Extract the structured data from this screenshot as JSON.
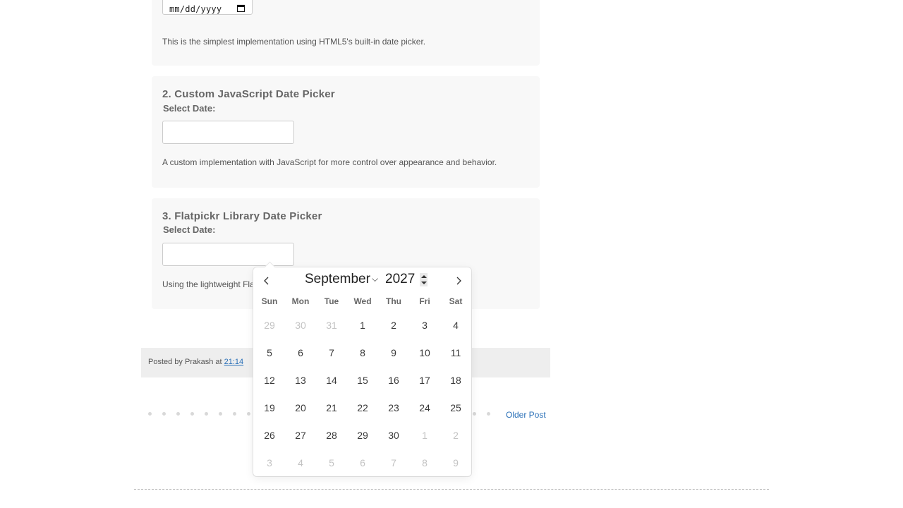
{
  "section1": {
    "date_placeholder": "mm/dd/yyyy",
    "description": "This is the simplest implementation using HTML5's built-in date picker."
  },
  "section2": {
    "title": "2. Custom JavaScript Date Picker",
    "label": "Select Date:",
    "description": "A custom implementation with JavaScript for more control over appearance and behavior."
  },
  "section3": {
    "title": "3. Flatpickr Library Date Picker",
    "label": "Select Date:",
    "description_visible": "Using the lightweight Fla"
  },
  "footer": {
    "posted_by_prefix": "Posted by Prakash at",
    "time": "21:14",
    "older_post": "Older Post"
  },
  "calendar": {
    "month": "September",
    "year": "2027",
    "weekdays": [
      "Sun",
      "Mon",
      "Tue",
      "Wed",
      "Thu",
      "Fri",
      "Sat"
    ],
    "weeks": [
      [
        {
          "d": "29",
          "m": true
        },
        {
          "d": "30",
          "m": true
        },
        {
          "d": "31",
          "m": true
        },
        {
          "d": "1"
        },
        {
          "d": "2"
        },
        {
          "d": "3"
        },
        {
          "d": "4"
        }
      ],
      [
        {
          "d": "5"
        },
        {
          "d": "6"
        },
        {
          "d": "7"
        },
        {
          "d": "8"
        },
        {
          "d": "9"
        },
        {
          "d": "10"
        },
        {
          "d": "11"
        }
      ],
      [
        {
          "d": "12"
        },
        {
          "d": "13"
        },
        {
          "d": "14"
        },
        {
          "d": "15"
        },
        {
          "d": "16"
        },
        {
          "d": "17"
        },
        {
          "d": "18"
        }
      ],
      [
        {
          "d": "19"
        },
        {
          "d": "20"
        },
        {
          "d": "21"
        },
        {
          "d": "22"
        },
        {
          "d": "23"
        },
        {
          "d": "24"
        },
        {
          "d": "25"
        }
      ],
      [
        {
          "d": "26"
        },
        {
          "d": "27"
        },
        {
          "d": "28"
        },
        {
          "d": "29"
        },
        {
          "d": "30"
        },
        {
          "d": "1",
          "m": true
        },
        {
          "d": "2",
          "m": true
        }
      ],
      [
        {
          "d": "3",
          "m": true
        },
        {
          "d": "4",
          "m": true
        },
        {
          "d": "5",
          "m": true
        },
        {
          "d": "6",
          "m": true
        },
        {
          "d": "7",
          "m": true
        },
        {
          "d": "8",
          "m": true
        },
        {
          "d": "9",
          "m": true
        }
      ]
    ]
  },
  "colors": {
    "link": "#2a70b8",
    "card_bg": "#f8f8f8",
    "footer_bg": "#eeeeee"
  }
}
